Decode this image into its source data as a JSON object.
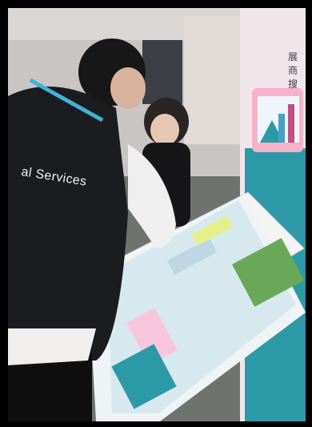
{
  "scene": {
    "vest_print": "al Services",
    "sign_text": "展商搜"
  },
  "colors": {
    "frame": "#000000",
    "wall": "#d6d2cf",
    "floor": "#6b6f6c",
    "booth_panel": "#2c9aa6",
    "kiosk": "#f1f1f1",
    "screen": "#e7f2f5",
    "vest": "#1b1c20"
  }
}
